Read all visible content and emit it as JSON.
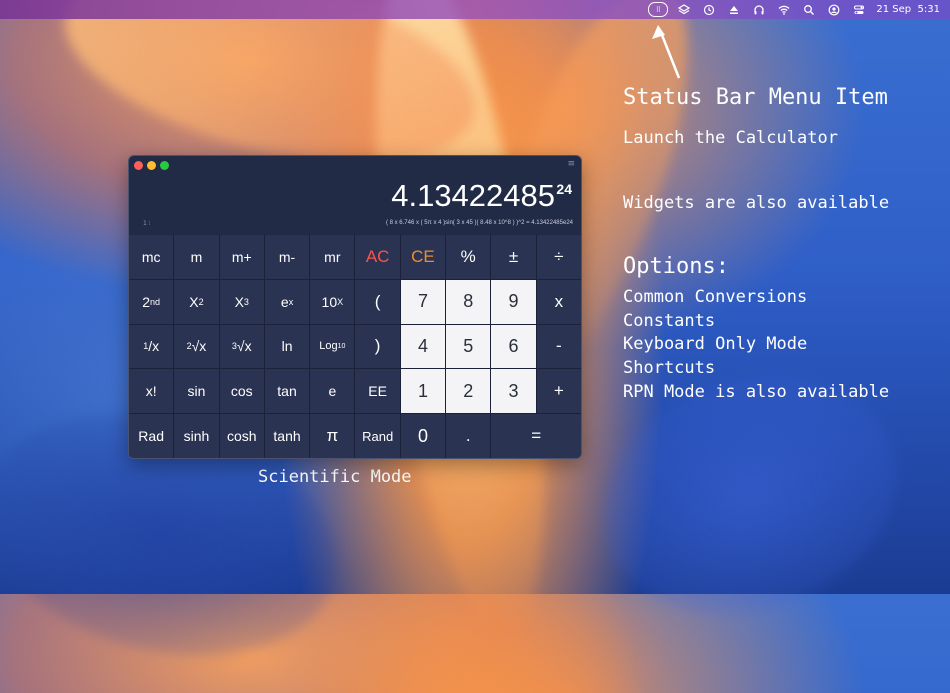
{
  "menubar": {
    "date": "21 Sep",
    "time": "5:31",
    "icons": [
      "calculator-menu-icon",
      "layers-icon",
      "time-machine-icon",
      "eject-icon",
      "headphones-icon",
      "wifi-icon",
      "search-icon",
      "user-icon",
      "control-center-icon"
    ]
  },
  "annotations": {
    "status_title": "Status Bar Menu Item",
    "status_sub": "Launch the Calculator",
    "widgets": "Widgets are also available",
    "options_title": "Options:",
    "options": [
      "Common Conversions",
      "Constants",
      "Keyboard Only Mode",
      "Shortcuts",
      "RPN Mode is also available"
    ],
    "scientific_caption": "Scientific Mode"
  },
  "calculator": {
    "display_value": "4.13422485",
    "display_exponent": "24",
    "expression_left": "1 ⁝",
    "expression": "( 8 x 6.746 x ( 5π x 4 )sin( 3 x 45 )( 8.48 x 10^8 ) )^2 = 4.13422485e24",
    "keys": {
      "mc": "mc",
      "m": "m",
      "mplus": "m+",
      "mminus": "m-",
      "mr": "mr",
      "ac": "AC",
      "ce": "CE",
      "percent": "%",
      "plusminus": "±",
      "divide": "÷",
      "second": "2",
      "second_sup": "nd",
      "x2": "X",
      "x2_sup": "2",
      "x3": "X",
      "x3_sup": "3",
      "ex": "e",
      "ex_sup": "x",
      "tenx": "10",
      "tenx_sup": "X",
      "lparen": "(",
      "k7": "7",
      "k8": "8",
      "k9": "9",
      "multiply": "x",
      "recip_sup": "1",
      "recip": "/x",
      "sqrt2_sup": "2",
      "sqrt2": "√x",
      "sqrt3_sup": "3",
      "sqrt3": "√x",
      "ln": "ln",
      "log": "Log",
      "log_sub": "10",
      "rparen": ")",
      "k4": "4",
      "k5": "5",
      "k6": "6",
      "minus": "-",
      "fact": "x!",
      "sin": "sin",
      "cos": "cos",
      "tan": "tan",
      "e": "e",
      "ee": "EE",
      "k1": "1",
      "k2": "2",
      "k3": "3",
      "plus": "+",
      "rad": "Rad",
      "sinh": "sinh",
      "cosh": "cosh",
      "tanh": "tanh",
      "pi": "π",
      "rand": "Rand",
      "k0": "0",
      "dot": ".",
      "equals": "="
    }
  }
}
